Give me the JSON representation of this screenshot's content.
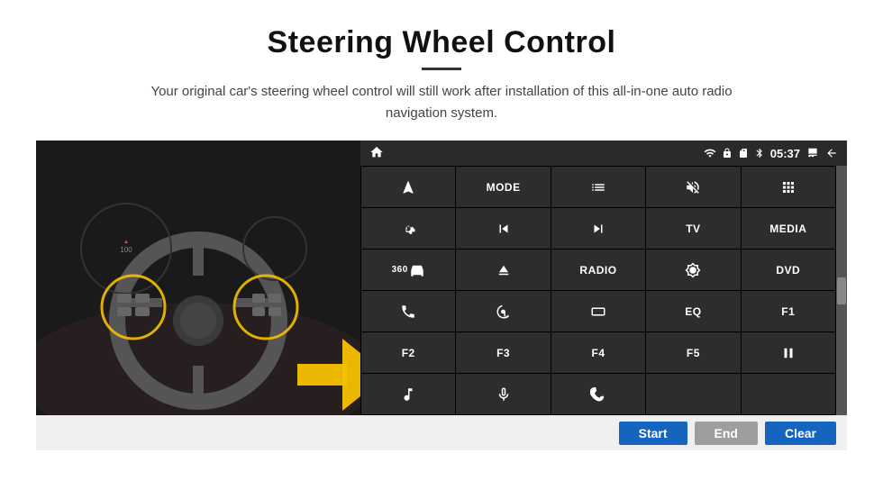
{
  "header": {
    "title": "Steering Wheel Control",
    "divider": true,
    "subtitle": "Your original car's steering wheel control will still work after installation of this all-in-one auto radio navigation system."
  },
  "status_bar": {
    "home_icon": "home",
    "wifi_icon": "wifi",
    "lock_icon": "lock",
    "sd_icon": "sd",
    "bluetooth_icon": "bluetooth",
    "time": "05:37",
    "screen_icon": "screen",
    "back_icon": "back"
  },
  "buttons": [
    {
      "id": "r1c1",
      "type": "icon",
      "icon": "navigate",
      "label": ""
    },
    {
      "id": "r1c2",
      "type": "text",
      "label": "MODE"
    },
    {
      "id": "r1c3",
      "type": "icon",
      "icon": "list"
    },
    {
      "id": "r1c4",
      "type": "icon",
      "icon": "mute"
    },
    {
      "id": "r1c5",
      "type": "icon",
      "icon": "apps"
    },
    {
      "id": "r2c1",
      "type": "icon",
      "icon": "settings-circle"
    },
    {
      "id": "r2c2",
      "type": "icon",
      "icon": "prev"
    },
    {
      "id": "r2c3",
      "type": "icon",
      "icon": "next"
    },
    {
      "id": "r2c4",
      "type": "text",
      "label": "TV"
    },
    {
      "id": "r2c5",
      "type": "text",
      "label": "MEDIA"
    },
    {
      "id": "r3c1",
      "type": "icon",
      "icon": "360"
    },
    {
      "id": "r3c2",
      "type": "icon",
      "icon": "eject"
    },
    {
      "id": "r3c3",
      "type": "text",
      "label": "RADIO"
    },
    {
      "id": "r3c4",
      "type": "icon",
      "icon": "brightness"
    },
    {
      "id": "r3c5",
      "type": "text",
      "label": "DVD"
    },
    {
      "id": "r4c1",
      "type": "icon",
      "icon": "phone"
    },
    {
      "id": "r4c2",
      "type": "icon",
      "icon": "swipe"
    },
    {
      "id": "r4c3",
      "type": "icon",
      "icon": "rectangle"
    },
    {
      "id": "r4c4",
      "type": "text",
      "label": "EQ"
    },
    {
      "id": "r4c5",
      "type": "text",
      "label": "F1"
    },
    {
      "id": "r5c1",
      "type": "text",
      "label": "F2"
    },
    {
      "id": "r5c2",
      "type": "text",
      "label": "F3"
    },
    {
      "id": "r5c3",
      "type": "text",
      "label": "F4"
    },
    {
      "id": "r5c4",
      "type": "text",
      "label": "F5"
    },
    {
      "id": "r5c5",
      "type": "icon",
      "icon": "play-pause"
    },
    {
      "id": "r6c1",
      "type": "icon",
      "icon": "music"
    },
    {
      "id": "r6c2",
      "type": "icon",
      "icon": "mic"
    },
    {
      "id": "r6c3",
      "type": "icon",
      "icon": "phone-end"
    },
    {
      "id": "r6c4",
      "type": "text",
      "label": ""
    },
    {
      "id": "r6c5",
      "type": "text",
      "label": ""
    }
  ],
  "action_bar": {
    "start_label": "Start",
    "end_label": "End",
    "clear_label": "Clear"
  }
}
